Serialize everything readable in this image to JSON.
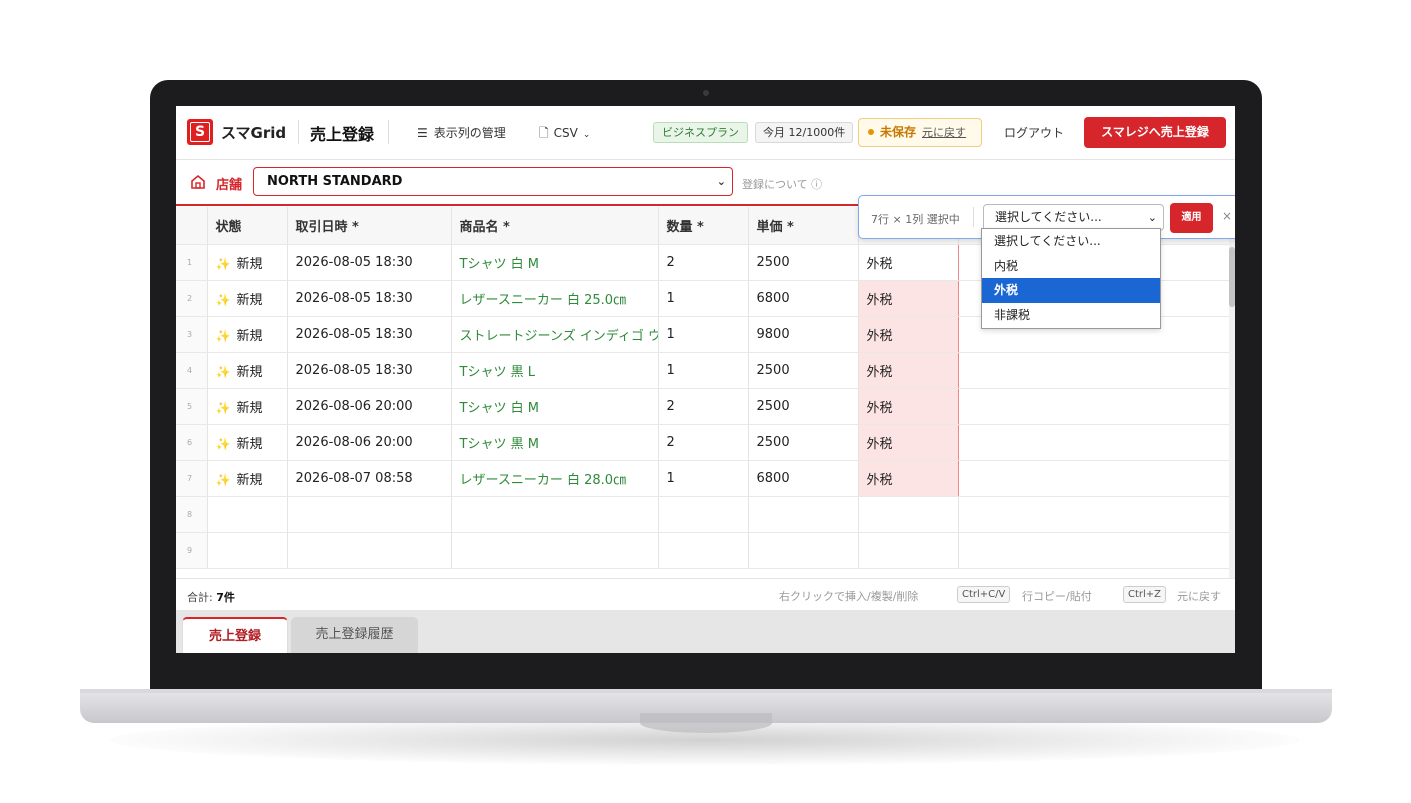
{
  "header": {
    "app_name": "スマGrid",
    "page_title": "売上登録",
    "menu_columns": "表示列の管理",
    "menu_csv": "CSV",
    "plan_badge": "ビジネスプラン",
    "quota_badge": "今月 12/1000件",
    "unsaved_status": "未保存",
    "undo_link": "元に戻す",
    "logout": "ログアウト",
    "submit_button": "スマレジへ売上登録"
  },
  "store": {
    "label": "店舗",
    "selected": "NORTH STANDARD",
    "about_link": "登録について ⓘ"
  },
  "grid": {
    "columns": [
      "状態",
      "取引日時 *",
      "商品名 *",
      "数量 *",
      "単価 *",
      "",
      ""
    ],
    "rows": [
      {
        "num": "1",
        "status": "新規",
        "datetime": "2026-08-05 18:30",
        "product": "Tシャツ 白 M",
        "qty": "2",
        "price": "2500",
        "tax": "外税"
      },
      {
        "num": "2",
        "status": "新規",
        "datetime": "2026-08-05 18:30",
        "product": "レザースニーカー 白 25.0㎝",
        "qty": "1",
        "price": "6800",
        "tax": "外税"
      },
      {
        "num": "3",
        "status": "新規",
        "datetime": "2026-08-05 18:30",
        "product": "ストレートジーンズ インディゴ ウ",
        "qty": "1",
        "price": "9800",
        "tax": "外税"
      },
      {
        "num": "4",
        "status": "新規",
        "datetime": "2026-08-05 18:30",
        "product": "Tシャツ 黒 L",
        "qty": "1",
        "price": "2500",
        "tax": "外税"
      },
      {
        "num": "5",
        "status": "新規",
        "datetime": "2026-08-06 20:00",
        "product": "Tシャツ 白 M",
        "qty": "2",
        "price": "2500",
        "tax": "外税"
      },
      {
        "num": "6",
        "status": "新規",
        "datetime": "2026-08-06 20:00",
        "product": "Tシャツ 黒 M",
        "qty": "2",
        "price": "2500",
        "tax": "外税"
      },
      {
        "num": "7",
        "status": "新規",
        "datetime": "2026-08-07 08:58",
        "product": "レザースニーカー 白 28.0㎝",
        "qty": "1",
        "price": "6800",
        "tax": "外税"
      }
    ],
    "empty_rows": [
      "8",
      "9"
    ]
  },
  "footer": {
    "total_label": "合計:",
    "total_value": "7件",
    "hint_right_click": "右クリックで挿入/複製/削除",
    "kbd_copy": "Ctrl+C/V",
    "hint_copy": "行コピー/貼付",
    "kbd_undo": "Ctrl+Z",
    "hint_undo": "元に戻す"
  },
  "batch_edit": {
    "selection_info": "7行 × 1列 選択中",
    "select_placeholder": "選択してください...",
    "apply_button": "適用",
    "close": "×",
    "options": [
      "選択してください...",
      "内税",
      "外税",
      "非課税"
    ],
    "highlighted_option": "外税"
  },
  "tabs": [
    "売上登録",
    "売上登録履歴"
  ],
  "colors": {
    "accent": "#d7262b",
    "product_text": "#2e8b3a",
    "dropdown_highlight": "#1a66d2"
  }
}
